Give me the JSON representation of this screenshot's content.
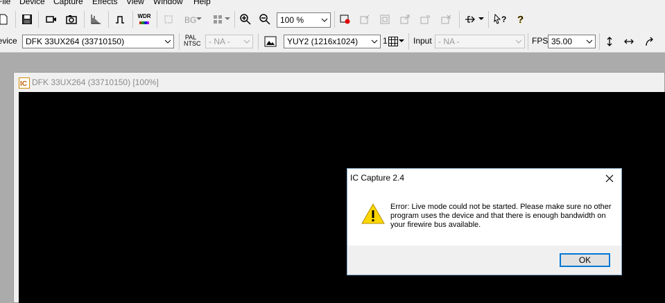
{
  "menu": [
    "File",
    "Device",
    "Capture",
    "Effects",
    "View",
    "Window",
    "Help"
  ],
  "toolbar1": {
    "zoom_value": "100 %",
    "bg_label": "BG",
    "wdr_label": "WDR"
  },
  "toolbar2": {
    "device_label": "Device",
    "device_value": "DFK 33UX264 (33710150)",
    "pal_label": "PAL",
    "ntsc_label": "NTSC",
    "video_norm_value": "- NA -",
    "format_value": "YUY2 (1216x1024)",
    "binning_value": "1",
    "input_label": "Input",
    "input_value": "- NA -",
    "fps_label": "FPS",
    "fps_value": "35.00"
  },
  "child_window": {
    "title": "DFK 33UX264 (33710150) [100%]"
  },
  "dialog": {
    "title": "IC Capture 2.4",
    "message": "Error: Live mode could not be started. Please make sure no other program uses the device and that there is enough bandwidth on your firewire bus available.",
    "ok_label": "OK"
  },
  "colors": {
    "warning": "#ffd700",
    "focus_border": "#0078d7",
    "video_bg": "#000000"
  }
}
